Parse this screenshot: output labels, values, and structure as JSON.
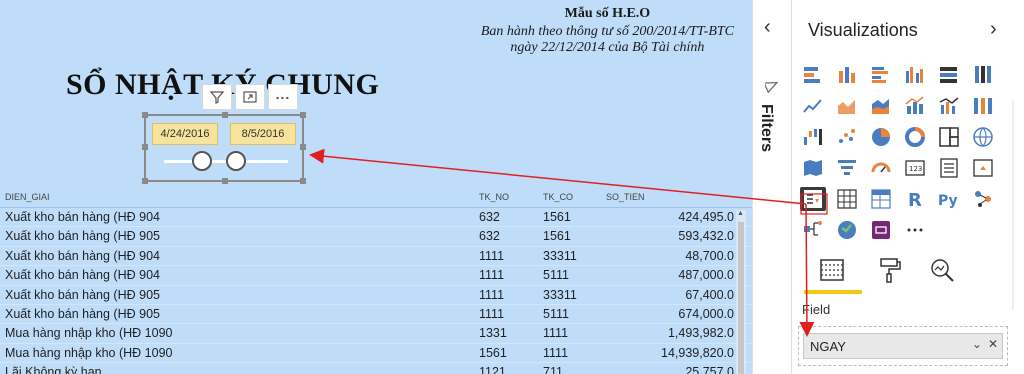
{
  "report": {
    "form_code": "Mẫu số H.E.O",
    "issued_by": "Ban hành theo thông tư số 200/2014/TT-BTC",
    "issued_date": "ngày 22/12/2014 của Bộ Tài chính",
    "title": "SỔ NHẬT KÝ CHUNG"
  },
  "slicer": {
    "start_date": "4/24/2016",
    "end_date": "8/5/2016",
    "more_label": "..."
  },
  "table": {
    "headers": [
      "DIEN_GIAI",
      "TK_NO",
      "TK_CO",
      "SO_TIEN"
    ],
    "rows": [
      [
        "Xuất kho bán hàng (HĐ 904",
        "632",
        "1561",
        "424,495.0"
      ],
      [
        "Xuất kho bán hàng (HĐ 905",
        "632",
        "1561",
        "593,432.0"
      ],
      [
        "Xuất kho bán hàng (HĐ 904",
        "1111",
        "33311",
        "48,700.0"
      ],
      [
        "Xuất kho bán hàng (HĐ 904",
        "1111",
        "5111",
        "487,000.0"
      ],
      [
        "Xuất kho bán hàng (HĐ 905",
        "1111",
        "33311",
        "67,400.0"
      ],
      [
        "Xuất kho bán hàng (HĐ 905",
        "1111",
        "5111",
        "674,000.0"
      ],
      [
        "Mua hàng nhập kho (HĐ 1090",
        "1331",
        "1111",
        "1,493,982.0"
      ],
      [
        "Mua hàng nhập kho (HĐ 1090",
        "1561",
        "1111",
        "14,939,820.0"
      ],
      [
        "Lãi Không kỳ hạn",
        "1121",
        "711",
        "25,757.0"
      ]
    ]
  },
  "filters": {
    "label": "Filters"
  },
  "visualizations": {
    "title": "Visualizations",
    "more_label": "...",
    "icons": [
      "stacked-bar-chart-icon",
      "stacked-column-chart-icon",
      "clustered-bar-chart-icon",
      "clustered-column-chart-icon",
      "100-stacked-bar-chart-icon",
      "100-stacked-column-chart-icon",
      "line-chart-icon",
      "area-chart-icon",
      "stacked-area-chart-icon",
      "line-and-stacked-column-icon",
      "line-and-clustered-column-icon",
      "ribbon-chart-icon",
      "waterfall-chart-icon",
      "scatter-chart-icon",
      "pie-chart-icon",
      "donut-chart-icon",
      "treemap-icon",
      "map-icon",
      "filled-map-icon",
      "funnel-icon",
      "gauge-icon",
      "card-icon",
      "multi-row-card-icon",
      "kpi-icon",
      "slicer-icon",
      "table-icon",
      "matrix-icon",
      "r-script-icon",
      "python-icon",
      "key-influencers-icon",
      "decomposition-tree-icon",
      "arcgis-map-icon",
      "power-apps-icon",
      "more-visuals-icon"
    ],
    "tabs": [
      "fields-tab",
      "format-tab",
      "analytics-tab"
    ],
    "field_label": "Field",
    "field_value": "NGAY"
  },
  "colors": {
    "canvas_bg": "#bfddf9",
    "slicer_date_bg": "#f7e39c",
    "accent_yellow": "#f2c811",
    "arrow_red": "#e02020",
    "selected_icon_bg": "#3b3a39"
  }
}
